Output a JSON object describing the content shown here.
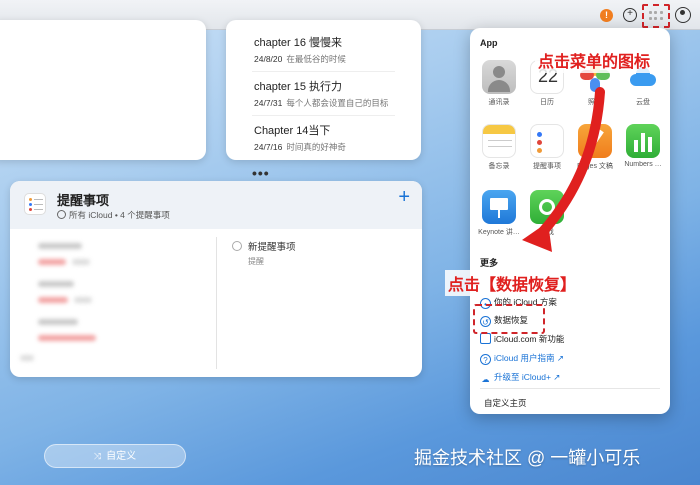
{
  "topbar": {
    "alert_badge": "!",
    "add_symbol": "+"
  },
  "notes": {
    "items": [
      {
        "title": "chapter 16 慢慢来",
        "date": "24/8/20",
        "preview": "在最低谷的时候"
      },
      {
        "title": "chapter 15 执行力",
        "date": "24/7/31",
        "preview": "每个人都会设置自己的目标"
      },
      {
        "title": "Chapter 14当下",
        "date": "24/7/16",
        "preview": "时间真的好神奇"
      }
    ],
    "more": "•••"
  },
  "reminders": {
    "title": "提醒事项",
    "subtitle": "所有 iCloud • 4 个提醒事项",
    "add_symbol": "+",
    "new_item": "新提醒事项",
    "new_item_sub": "提醒"
  },
  "customize_button": {
    "label": "自定义",
    "icon_symbol": "⤨"
  },
  "watermark": "掘金技术社区 @ 一罐小可乐",
  "popover": {
    "app_section": "App",
    "apps": [
      {
        "label": "通讯录",
        "icon": "contacts-icon"
      },
      {
        "label": "日历",
        "icon": "calendar-icon",
        "day": "22"
      },
      {
        "label": "照片",
        "icon": "photos-icon"
      },
      {
        "label": "云盘",
        "icon": "icloud-drive-icon"
      },
      {
        "label": "备忘录",
        "icon": "notes-icon"
      },
      {
        "label": "提醒事项",
        "icon": "reminders-icon"
      },
      {
        "label": "Pages 文稿",
        "icon": "pages-icon"
      },
      {
        "label": "Numbers …",
        "icon": "numbers-icon"
      },
      {
        "label": "Keynote 讲…",
        "icon": "keynote-icon"
      },
      {
        "label": "查找",
        "icon": "find-icon"
      }
    ],
    "more_section": "更多",
    "menu": [
      {
        "label": "你的 iCloud 方案",
        "icon": "person-icon",
        "style": "dark"
      },
      {
        "label": "数据恢复",
        "icon": "recovery-icon",
        "style": "dark"
      },
      {
        "label": "iCloud.com 新功能",
        "icon": "document-icon",
        "style": "dark"
      },
      {
        "label": "iCloud 用户指南 ↗",
        "icon": "help-icon",
        "style": "blue"
      },
      {
        "label": "升级至 iCloud+ ↗",
        "icon": "cloud-icon",
        "style": "blue"
      }
    ],
    "customize_home": "自定义主页"
  },
  "annotations": {
    "click_menu_icon": "点击菜单的图标",
    "click_recovery": "点击【数据恢复】"
  },
  "colors": {
    "accent_blue": "#1a73d6",
    "annotation_red": "#e0201f",
    "alert_orange": "#f17e20"
  }
}
